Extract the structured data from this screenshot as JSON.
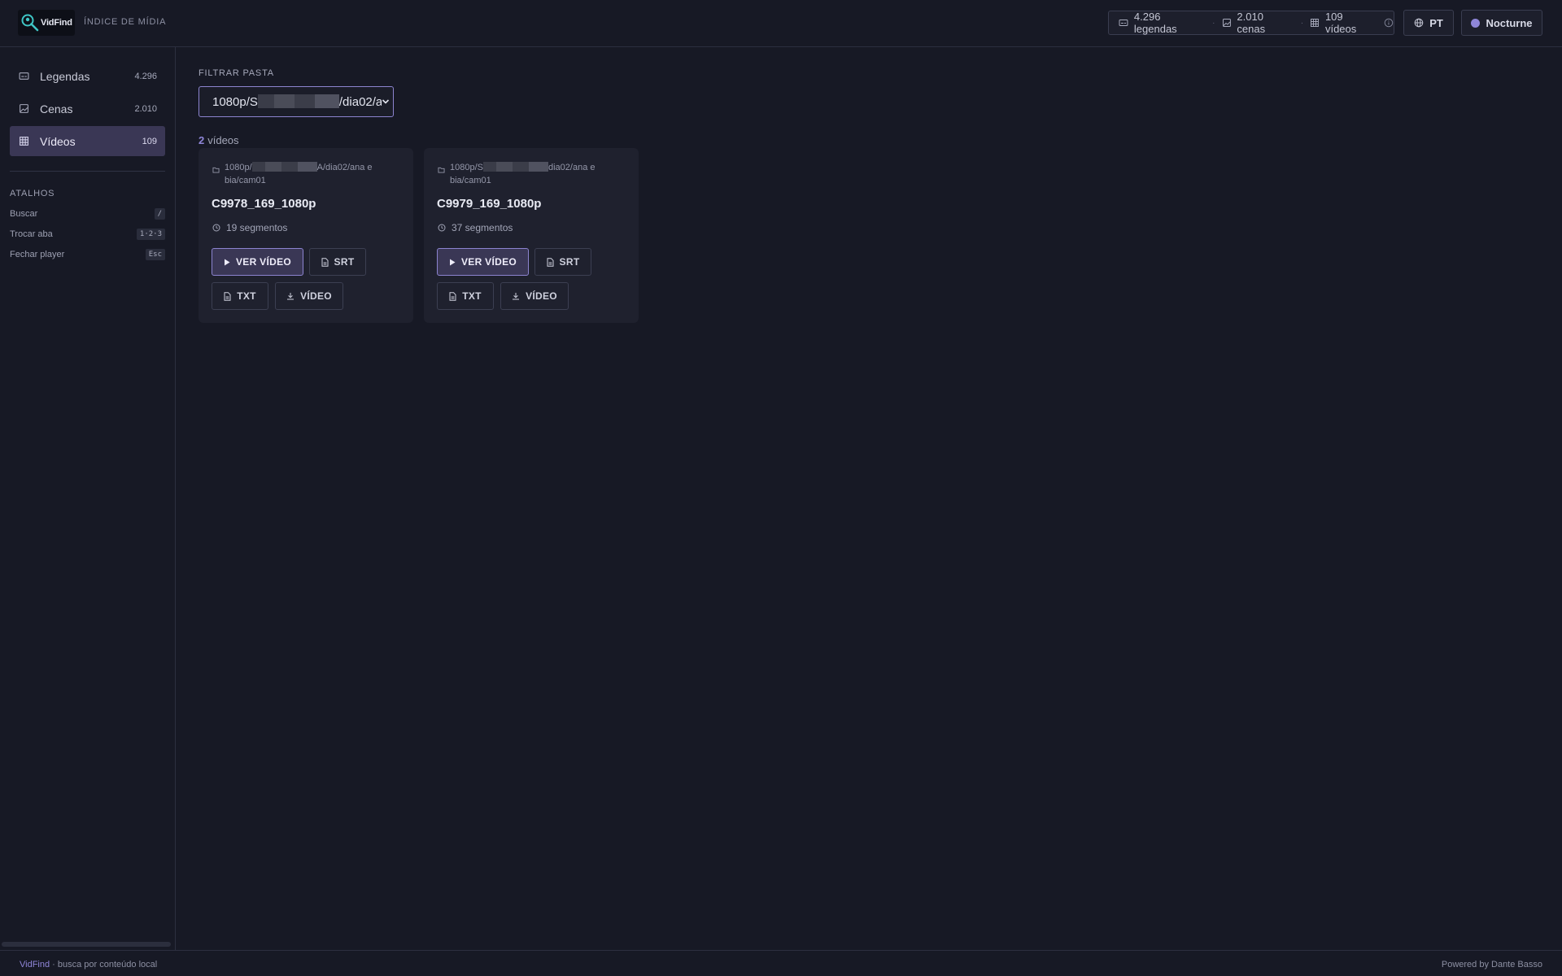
{
  "header": {
    "logo_text": "VidFind",
    "subtitle": "ÍNDICE DE MÍDIA",
    "stats": {
      "subtitles": "4.296 legendas",
      "scenes": "2.010 cenas",
      "videos": "109 vídeos"
    },
    "language_label": "PT",
    "theme_label": "Nocturne"
  },
  "sidebar": {
    "items": [
      {
        "label": "Legendas",
        "count": "4.296",
        "icon": "subtitles-icon"
      },
      {
        "label": "Cenas",
        "count": "2.010",
        "icon": "image-icon"
      },
      {
        "label": "Vídeos",
        "count": "109",
        "icon": "grid-icon",
        "active": true
      }
    ],
    "shortcuts_title": "ATALHOS",
    "shortcuts": [
      {
        "label": "Buscar",
        "key": "/"
      },
      {
        "label": "Trocar aba",
        "key": "1·2·3"
      },
      {
        "label": "Fechar player",
        "key": "Esc"
      }
    ]
  },
  "filter": {
    "label": "FILTRAR PASTA",
    "value_prefix": "1080p/S",
    "value_suffix": "/dia02/a"
  },
  "results": {
    "count": "2",
    "label": "vídeos"
  },
  "cards": [
    {
      "path_prefix": "1080p/",
      "path_suffix": "A/dia02/ana e",
      "path_line2": "bia/cam01",
      "title": "C9978_169_1080p",
      "segments": "19 segmentos",
      "watch_label": "VER VÍDEO",
      "srt_label": "SRT",
      "txt_label": "TXT",
      "download_label": "VÍDEO"
    },
    {
      "path_prefix": "1080p/S",
      "path_suffix": "dia02/ana e",
      "path_line2": "bia/cam01",
      "title": "C9979_169_1080p",
      "segments": "37 segmentos",
      "watch_label": "VER VÍDEO",
      "srt_label": "SRT",
      "txt_label": "TXT",
      "download_label": "VÍDEO"
    }
  ],
  "footer": {
    "brand": "VidFind",
    "tagline": " · busca por conteúdo local",
    "powered": "Powered by Dante Basso"
  },
  "colors": {
    "background": "#171925",
    "accent": "#8f86d8",
    "active_bg": "#3a3755"
  }
}
